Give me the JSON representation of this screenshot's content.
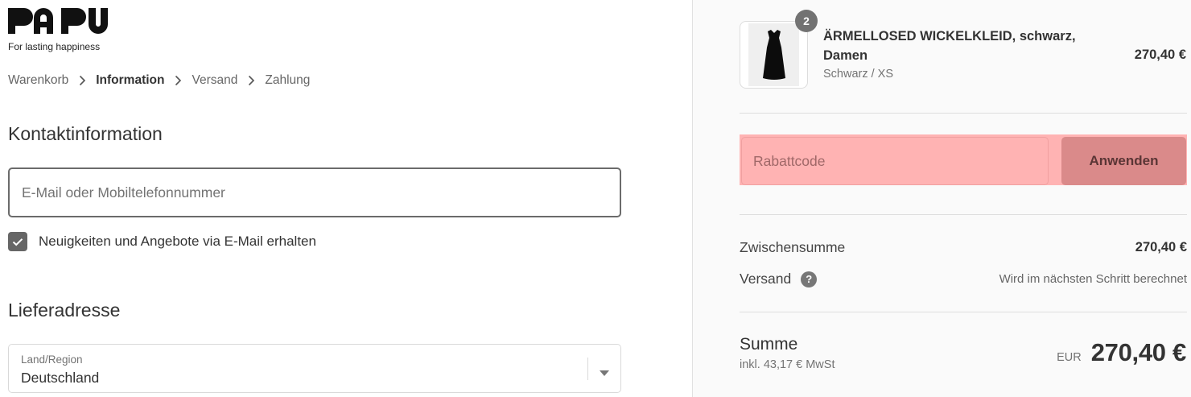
{
  "brand": {
    "tagline": "For lasting happiness"
  },
  "breadcrumb": [
    {
      "label": "Warenkorb",
      "active": false
    },
    {
      "label": "Information",
      "active": true
    },
    {
      "label": "Versand",
      "active": false
    },
    {
      "label": "Zahlung",
      "active": false
    }
  ],
  "contact": {
    "title": "Kontaktinformation",
    "email_placeholder": "E-Mail oder Mobiltelefonnummer",
    "newsletter_label": "Neuigkeiten und Angebote via E-Mail erhalten",
    "newsletter_checked": true
  },
  "shipping_address": {
    "title": "Lieferadresse",
    "country_label": "Land/Region",
    "country_value": "Deutschland"
  },
  "order_summary": {
    "product": {
      "name": "ÄRMELLOSED WICKELKLEID, schwarz, Damen",
      "variant": "Schwarz / XS",
      "price": "270,40 €",
      "quantity": "2"
    },
    "discount": {
      "placeholder": "Rabattcode",
      "button_label": "Anwenden"
    },
    "subtotal_label": "Zwischensumme",
    "subtotal_value": "270,40 €",
    "shipping_label": "Versand",
    "shipping_value": "Wird im nächsten Schritt berechnet",
    "total_label": "Summe",
    "tax_note": "inkl. 43,17 € MwSt",
    "currency": "EUR",
    "total_value": "270,40 €"
  },
  "colors": {
    "discount_highlight": "#ffb3b3",
    "apply_button": "#da8a8a",
    "summary_background": "#fafafa"
  }
}
